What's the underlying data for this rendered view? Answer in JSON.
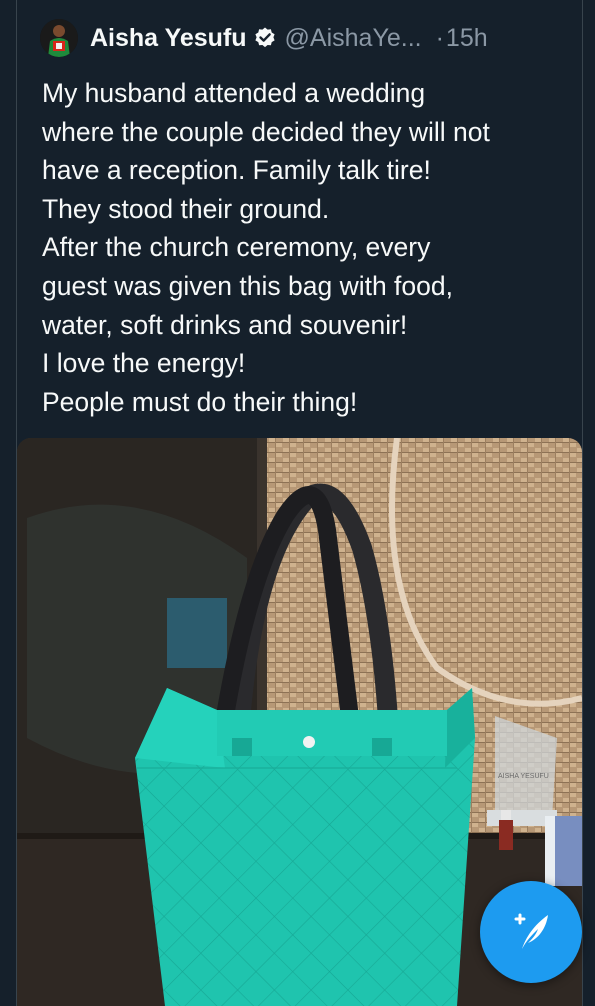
{
  "tweet": {
    "author_name": "Aisha Yesufu",
    "handle": "@AishaYe...",
    "separator": "·",
    "time": "15h",
    "text_lines": [
      "My husband attended a wedding",
      "where the couple decided they will not",
      "have a reception. Family talk tire!",
      "They stood their ground.",
      "After the church ceremony, every",
      "guest was given this bag with food,",
      "water, soft drinks and souvenir!",
      "I love the energy!",
      "People must do their thing!"
    ],
    "media": {
      "plaque_text": "AISHA YESUFU"
    }
  },
  "icons": {
    "avatar": "profile-avatar",
    "verified": "verified-badge-icon",
    "compose": "compose-tweet-icon"
  },
  "colors": {
    "background": "#15202b",
    "text_primary": "#f7f9f9",
    "text_secondary": "#8b98a5",
    "accent": "#1d9bf0",
    "bag": "#1fc4ae"
  }
}
